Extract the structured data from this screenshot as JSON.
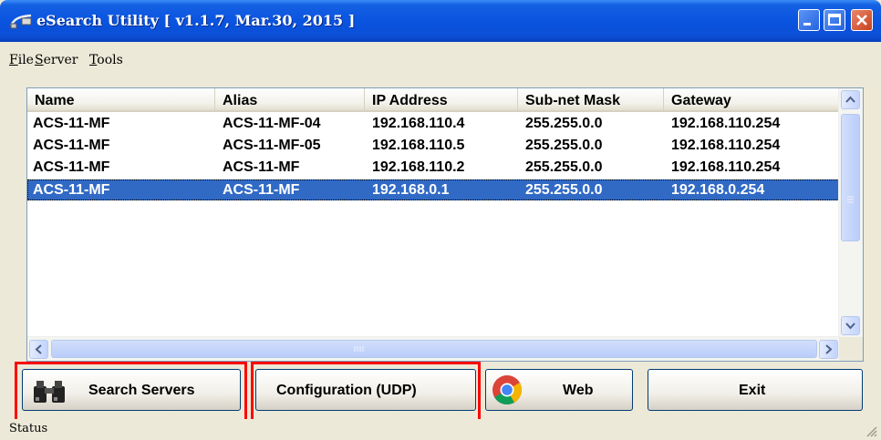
{
  "window": {
    "title": "eSearch Utility [ v1.1.7, Mar.30, 2015 ]"
  },
  "menu": [
    {
      "label": "File",
      "accel": "F",
      "rest": "ile"
    },
    {
      "label": "Server",
      "accel": "S",
      "rest": "erver"
    },
    {
      "label": "Tools",
      "accel": "T",
      "rest": "ools"
    }
  ],
  "table": {
    "columns": [
      "Name",
      "Alias",
      "IP Address",
      "Sub-net Mask",
      "Gateway"
    ],
    "rows": [
      {
        "name": "ACS-11-MF",
        "alias": "ACS-11-MF-04",
        "ip": "192.168.110.4",
        "mask": "255.255.0.0",
        "gateway": "192.168.110.254",
        "selected": false
      },
      {
        "name": "ACS-11-MF",
        "alias": "ACS-11-MF-05",
        "ip": "192.168.110.5",
        "mask": "255.255.0.0",
        "gateway": "192.168.110.254",
        "selected": false
      },
      {
        "name": "ACS-11-MF",
        "alias": "ACS-11-MF",
        "ip": "192.168.110.2",
        "mask": "255.255.0.0",
        "gateway": "192.168.110.254",
        "selected": false
      },
      {
        "name": "ACS-11-MF",
        "alias": "ACS-11-MF",
        "ip": "192.168.0.1",
        "mask": "255.255.0.0",
        "gateway": "192.168.0.254",
        "selected": true
      }
    ]
  },
  "buttons": {
    "search": "Search Servers",
    "config": "Configuration (UDP)",
    "web": "Web",
    "exit": "Exit"
  },
  "icons": {
    "app": "network-cable-icon",
    "search": "binoculars-icon",
    "web": "chrome-browser-icon"
  },
  "colors": {
    "titlebar": "#0A54E0",
    "selection": "#316AC5",
    "highlight": "#FF0000",
    "face": "#ECE9D8"
  },
  "status": {
    "text": "Status"
  }
}
